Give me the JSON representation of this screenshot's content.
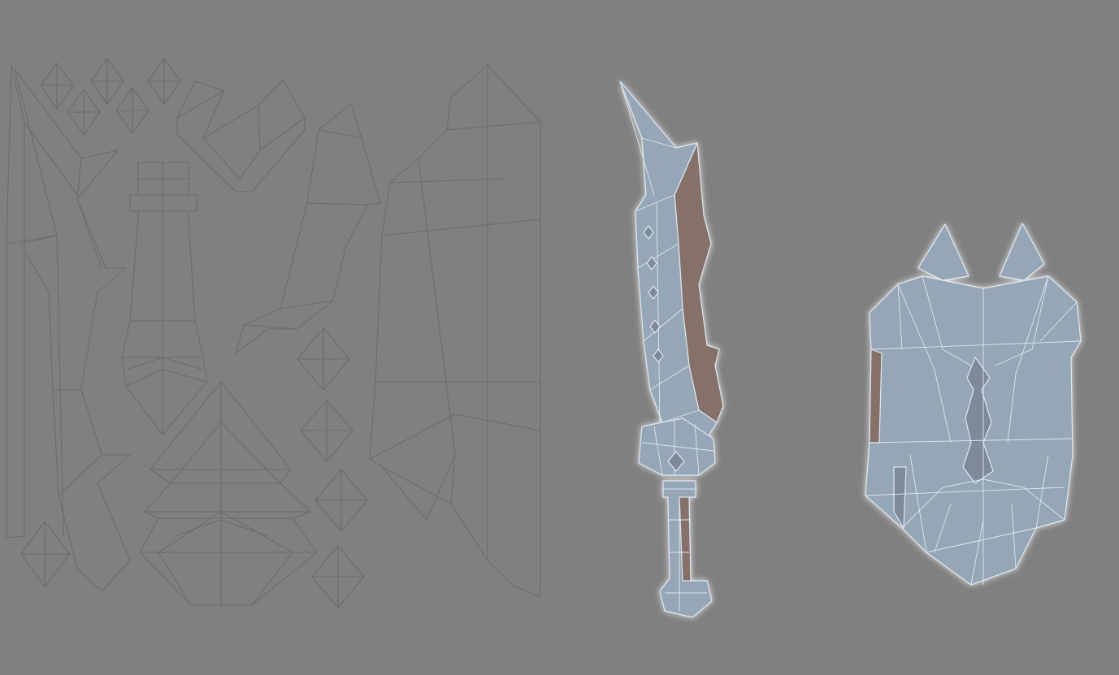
{
  "viewport": {
    "background": "#808080",
    "uv_line_color": "#6c6c6c",
    "mesh_fill": "#95a6b6",
    "mesh_shade": "#7b8a9a",
    "mesh_side": "#86706a",
    "wire_color": "#dfe6ee"
  },
  "objects": [
    {
      "name": "uv-layout",
      "kind": "uv-islands"
    },
    {
      "name": "sword-mesh",
      "kind": "3d-mesh"
    },
    {
      "name": "shield-mesh",
      "kind": "3d-mesh"
    }
  ]
}
